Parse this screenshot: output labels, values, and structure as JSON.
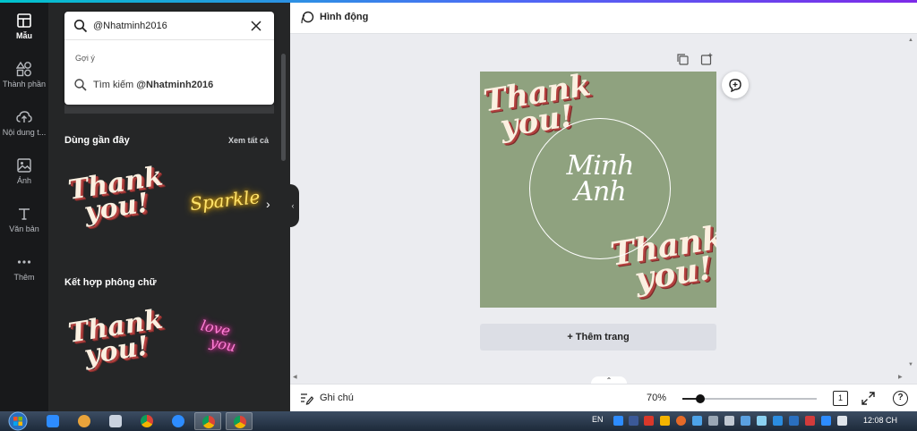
{
  "rail": {
    "items": [
      {
        "label": "Mẫu",
        "icon": "template-icon"
      },
      {
        "label": "Thành phần",
        "icon": "elements-icon"
      },
      {
        "label": "Nội dung t...",
        "icon": "upload-icon"
      },
      {
        "label": "Ảnh",
        "icon": "photo-icon"
      },
      {
        "label": "Văn bản",
        "icon": "text-icon"
      },
      {
        "label": "Thêm",
        "icon": "more-icon"
      }
    ]
  },
  "search": {
    "value": "@Nhatminh2016",
    "suggest_heading": "Gợi ý",
    "suggest_prefix": "Tìm kiếm ",
    "suggest_term": "@Nhatminh2016"
  },
  "recent": {
    "title": "Dùng gần đây",
    "see_all": "Xem tất cả",
    "items": [
      {
        "text_line1": "Thank",
        "text_line2": "you!"
      },
      {
        "text": "Sparkle"
      }
    ]
  },
  "combos": {
    "title": "Kết hợp phông chữ",
    "items": [
      {
        "text_line1": "Thank",
        "text_line2": "you!"
      },
      {
        "text_line1": "love",
        "text_line2": "you"
      }
    ]
  },
  "toolbar": {
    "animate_label": "Hình động"
  },
  "design": {
    "background_color": "#8fa27f",
    "top_text_line1": "Thank",
    "top_text_line2": "you!",
    "name_line1": "Minh",
    "name_line2": "Anh",
    "bottom_text_line1": "Thank",
    "bottom_text_line2": "you!"
  },
  "add_page_label": "+ Thêm trang",
  "bottombar": {
    "notes_label": "Ghi chú",
    "zoom_label": "70%",
    "zoom_level": 0.13,
    "page_count": "1",
    "help_label": "?"
  },
  "taskbar": {
    "language": "EN",
    "clock": "12:08 CH"
  },
  "colors": {
    "accent_gradient_start": "#00c4cc",
    "accent_gradient_end": "#7d2ae8",
    "panel_bg": "#252627",
    "rail_bg": "#18191b"
  }
}
